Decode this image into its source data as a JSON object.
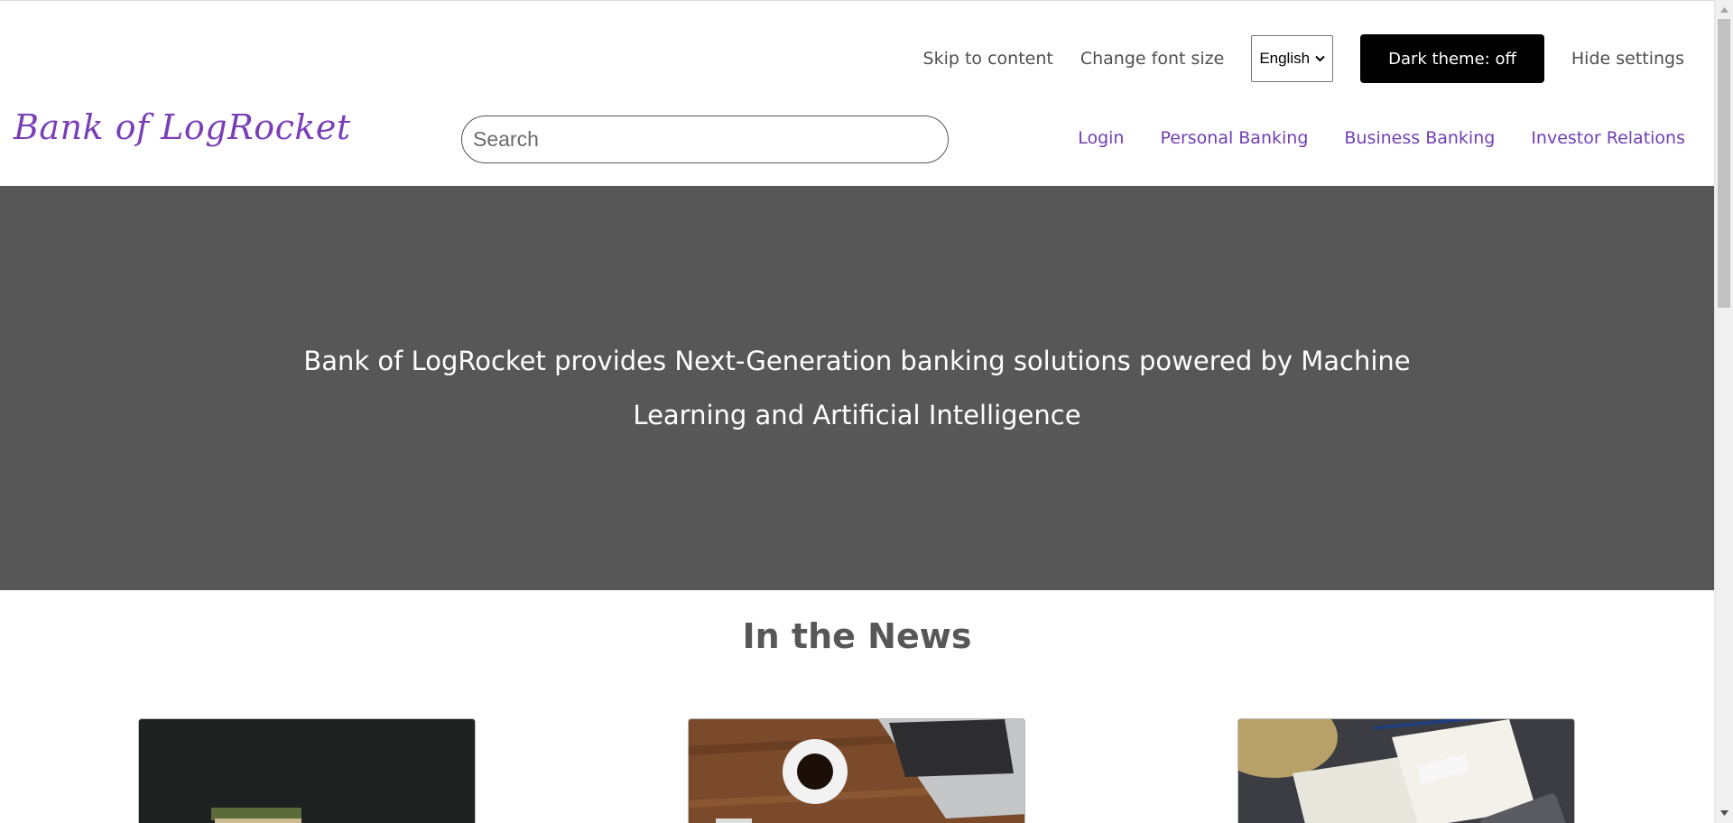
{
  "settings": {
    "skip_label": "Skip to content",
    "font_size_label": "Change font size",
    "language_selected": "English",
    "dark_theme_label": "Dark theme: off",
    "hide_label": "Hide settings"
  },
  "header": {
    "logo": "Bank of LogRocket",
    "search_placeholder": "Search",
    "nav": [
      "Login",
      "Personal Banking",
      "Business Banking",
      "Investor Relations"
    ]
  },
  "hero": {
    "text": "Bank of LogRocket provides Next-Generation banking solutions powered by Machine Learning and Artificial Intelligence"
  },
  "news": {
    "title": "In the News"
  },
  "colors": {
    "accent": "#6f3fb3",
    "hero_bg": "#575757",
    "dark_button": "#000000"
  }
}
